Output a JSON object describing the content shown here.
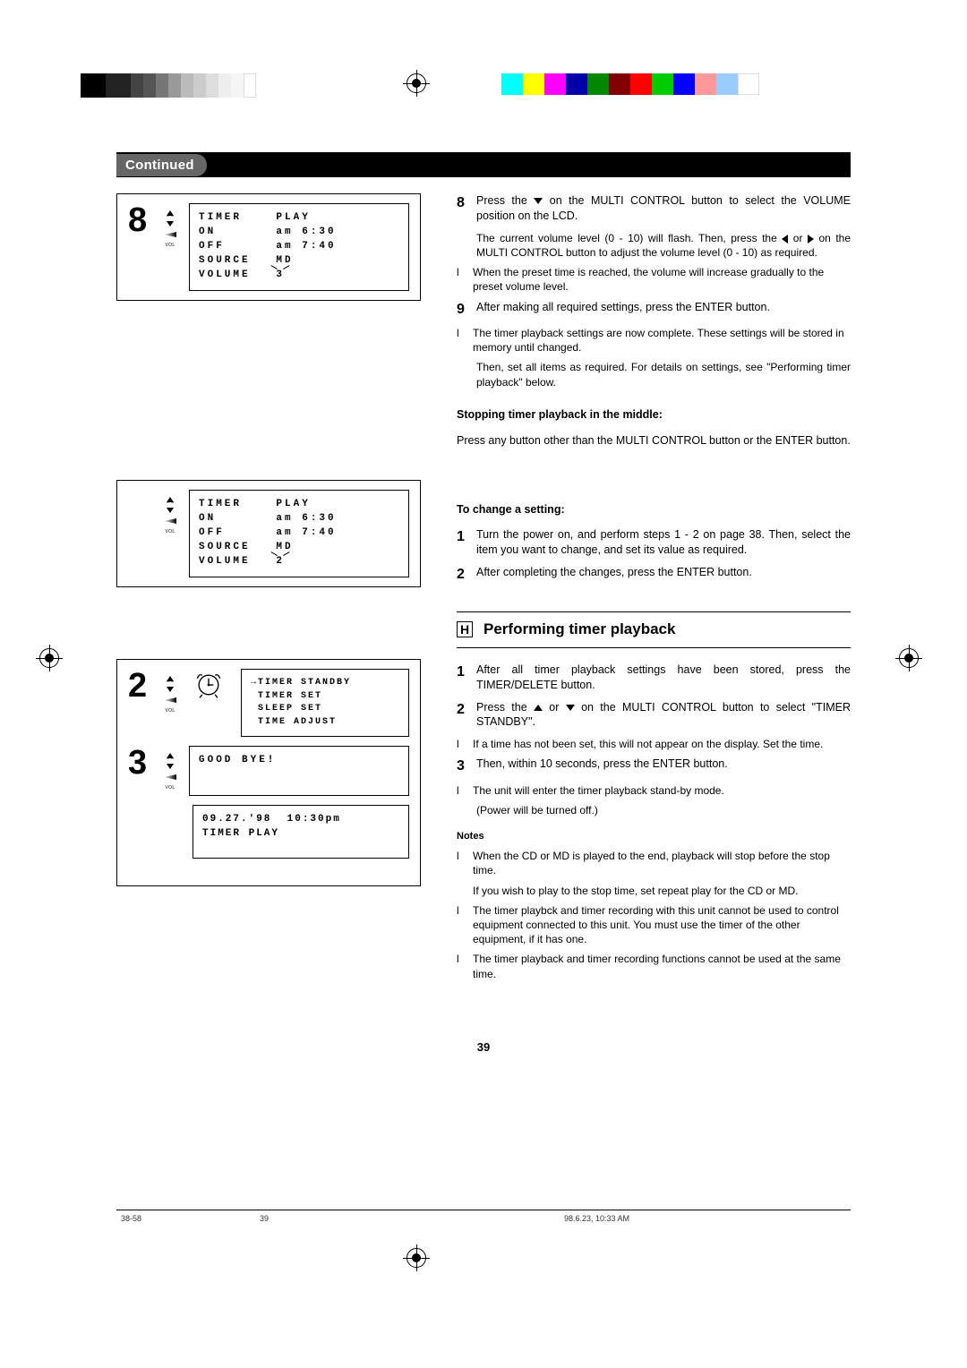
{
  "header": {
    "pill": "Continued"
  },
  "fig8": {
    "step": "8",
    "lines": [
      "TIMER    PLAY",
      "ON       am 6:30",
      "OFF      am 7:40",
      "SOURCE   MD",
      "VOLUME   ",
      "3"
    ]
  },
  "figA": {
    "lines": [
      "TIMER    PLAY",
      "ON       am 6:30",
      "OFF      am 7:40",
      "SOURCE   MD",
      "VOLUME   ",
      "2"
    ]
  },
  "figB": {
    "step2": "2",
    "step3": "3",
    "lcd1_arrow": "→",
    "lcd1_lines": [
      "TIMER STANDBY",
      "TIMER SET",
      "SLEEP SET",
      "TIME ADJUST"
    ],
    "lcd2": "GOOD BYE!",
    "lcd3_line1": "09.27.'98  10:30pm",
    "lcd3_line2": "TIMER PLAY"
  },
  "right": {
    "s8a": "Press the ",
    "s8b": " on the MULTI CONTROL button to select the VOLUME position on the LCD.",
    "s8c1": "The current volume level (0 - 10) will flash. Then, press the ",
    "s8c2": " or ",
    "s8c3": " on the MULTI CONTROL button to adjust the volume level (0 - 10) as required.",
    "s8_bul": "When the preset time is reached, the volume will increase gradually to the preset volume level.",
    "s9": "After making all required settings, press the ENTER button.",
    "s9_bul": "The timer playback settings are now complete. These settings will be stored in memory until changed.",
    "s9_sub": "Then, set all items as required. For details on settings, see \"Performing timer playback\" below.",
    "stop_h": "Stopping timer playback in the middle:",
    "stop_p": "Press any button other than the MULTI CONTROL button or the ENTER button.",
    "change_h": "To change a setting:",
    "c1": "Turn the power on, and perform steps 1 - 2 on page 38. Then, select the item you want to change, and set its value as required.",
    "c2": "After completing the changes, press the ENTER button.",
    "section_label": "H",
    "section_title": "Performing timer playback",
    "p1": "After all timer playback settings have been stored, press the TIMER/DELETE button.",
    "p2a": "Press the ",
    "p2b": " or ",
    "p2c": " on the MULTI CONTROL button to select \"TIMER STANDBY\".",
    "p2_bul": "If a time has not been set, this will not appear on the display. Set the time.",
    "p3": "Then, within 10 seconds, press the ENTER button.",
    "p3_bul": "The unit will enter the timer playback stand-by mode.",
    "p3_sub": "(Power will be turned off.)",
    "notes_h": "Notes",
    "n1": "When the CD or MD is played to the end, playback will stop before the stop time.",
    "n1b": "If you wish to play to the stop time, set repeat play for the CD or MD.",
    "n2": "The timer playbck and timer recording with this unit cannot be used to control equipment connected to this unit.  You must use the timer of the other equipment, if it has one.",
    "n3": "The timer playback and timer recording functions cannot be used at the same time."
  },
  "page_num": "39",
  "footer": {
    "left": "38-58",
    "mid": "39",
    "right": "98.6.23, 10:33 AM"
  }
}
